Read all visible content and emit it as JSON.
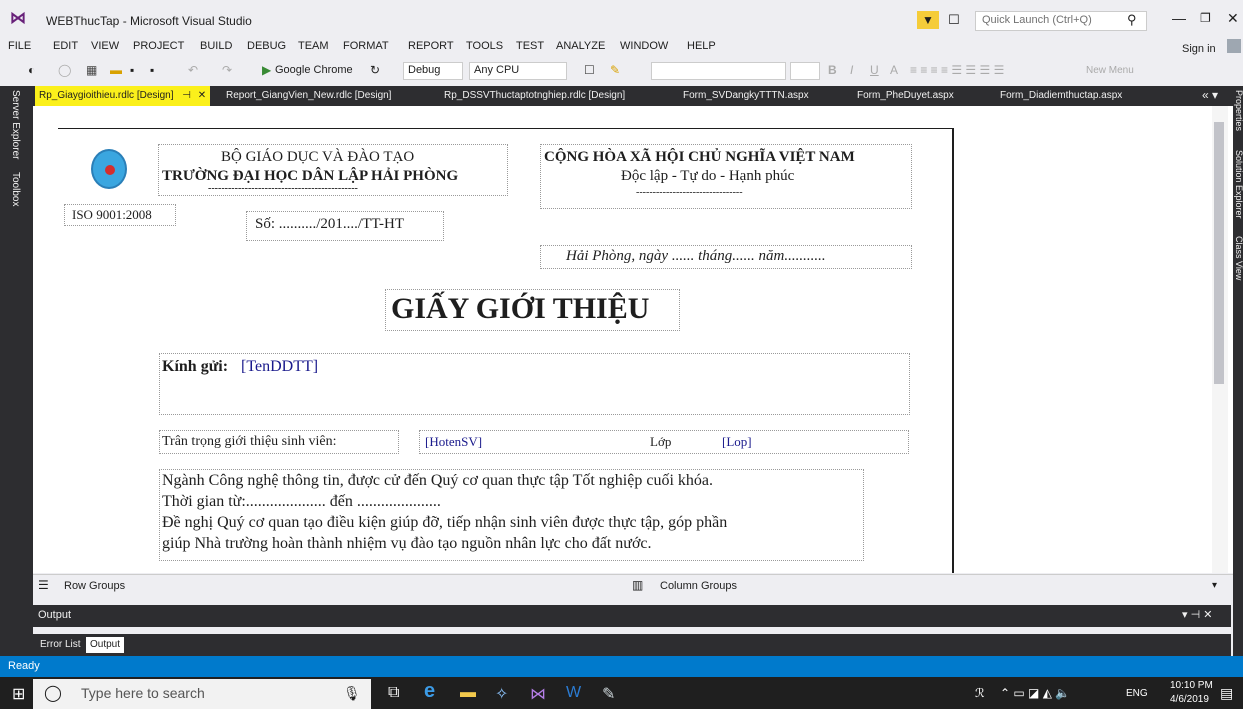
{
  "window": {
    "title": "WEBThucTap - Microsoft Visual Studio"
  },
  "quick_launch": {
    "placeholder": "Quick Launch (Ctrl+Q)"
  },
  "menu": [
    "FILE",
    "EDIT",
    "VIEW",
    "PROJECT",
    "BUILD",
    "DEBUG",
    "TEAM",
    "FORMAT",
    "REPORT",
    "TOOLS",
    "TEST",
    "ANALYZE",
    "WINDOW",
    "HELP"
  ],
  "sign_in": "Sign in",
  "toolbar": {
    "browser": "Google Chrome",
    "config": "Debug",
    "platform": "Any CPU",
    "new_menu": "New Menu"
  },
  "left_dock": {
    "server_explorer": "Server Explorer",
    "toolbox": "Toolbox"
  },
  "right_dock": {
    "properties": "Properties",
    "solution_explorer": "Solution Explorer",
    "class_view": "Class View"
  },
  "tabs": [
    "Rp_Giaygioithieu.rdlc [Design]",
    "Report_GiangVien_New.rdlc [Design]",
    "Rp_DSSVThuctaptotnghiep.rdlc [Design]",
    "Form_SVDangkyTTTN.aspx",
    "Form_PheDuyet.aspx",
    "Form_Diadiemthuctap.aspx"
  ],
  "report": {
    "ministry": "BỘ GIÁO DỤC VÀ ĐÀO TẠO",
    "school": "TRƯỜNG ĐẠI HỌC DÂN LẬP HẢI PHÒNG",
    "school_rule": "---------------------------------------------",
    "iso": "ISO 9001:2008",
    "number": "Số: ........../201..../TT-HT",
    "republic": "CỘNG HÒA XÃ HỘI CHỦ NGHĨA VIỆT NAM",
    "motto": "Độc lập - Tự do - Hạnh phúc",
    "motto_rule": "--------------------------------",
    "place_date": "Hải Phòng, ngày ...... tháng...... năm...........",
    "title": "GIẤY GIỚI THIỆU",
    "greeting_label": "Kính gửi:",
    "greeting_field": "[TenDDTT]",
    "intro_label": "Trân trọng giới thiệu sinh viên:",
    "student_field": "[HotenSV]",
    "class_label": "Lớp",
    "class_field": "[Lop]",
    "body_lines": [
      "Ngành Công nghệ thông tin, được cử đến Quý cơ quan thực tập Tốt nghiệp cuối khóa.",
      "Thời gian từ:.................... đến .....................",
      "Đề nghị Quý cơ quan tạo điều kiện giúp đỡ, tiếp nhận sinh viên được thực tập, góp phần",
      "giúp Nhà trường hoàn thành nhiệm vụ đào tạo nguồn nhân lực cho đất nước."
    ]
  },
  "groups": {
    "row": "Row Groups",
    "column": "Column Groups"
  },
  "output": {
    "title": "Output"
  },
  "bottom_tabs": [
    "Error List",
    "Output"
  ],
  "status": "Ready",
  "taskbar": {
    "search": "Type here to search",
    "lang": "ENG",
    "time": "10:10 PM",
    "date": "4/6/2019"
  }
}
